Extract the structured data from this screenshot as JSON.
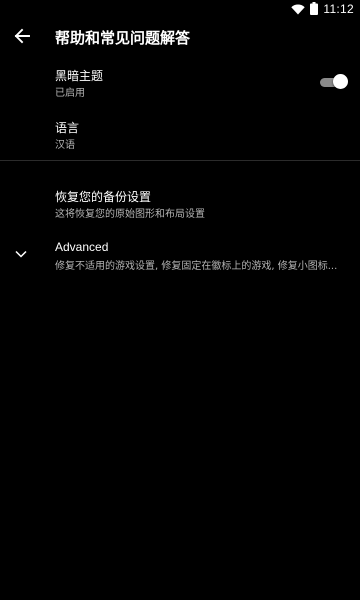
{
  "status_bar": {
    "time": "11:12",
    "icons": [
      "wifi-icon",
      "battery-icon"
    ]
  },
  "toolbar": {
    "back_icon": "arrow-back-icon",
    "title": "帮助和常见问题解答"
  },
  "preferences": {
    "dark_theme": {
      "title": "黑暗主题",
      "summary": "已启用",
      "enabled": true
    },
    "language": {
      "title": "语言",
      "summary": "汉语"
    },
    "restore_backup": {
      "title": "恢复您的备份设置",
      "summary": "这将恢复您的原始图形和布局设置"
    },
    "advanced": {
      "title": "Advanced",
      "summary": "修复不适用的游戏设置, 修复固定在徽标上的游戏, 修复小图标...",
      "icon": "chevron-down-icon"
    }
  },
  "colors": {
    "background": "#000000",
    "text_primary": "#ffffff",
    "text_secondary": "#b3b3b3",
    "divider": "#2b2b2b",
    "toggle_track": "#8a8a8a",
    "toggle_thumb": "#ffffff"
  }
}
